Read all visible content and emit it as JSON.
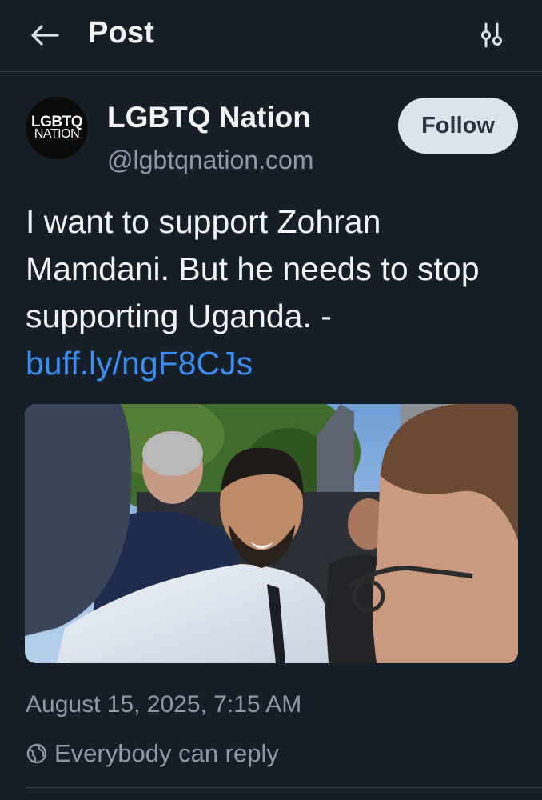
{
  "header": {
    "title": "Post",
    "back_icon": "arrow-left-icon",
    "filter_icon": "sliders-icon"
  },
  "author": {
    "avatar_line1": "LGBTQ",
    "avatar_line2": "NATION",
    "name": "LGBTQ Nation",
    "handle": "@lgbtqnation.com",
    "follow_label": "Follow"
  },
  "post": {
    "text": "I want to support Zohran Mamdani. But he needs to stop supporting Uganda. -",
    "link": "buff.ly/ngF8CJs",
    "image_alt": "Photo of a smiling bearded man in a white shirt and dark tie surrounded by a crowd outdoors",
    "date": "August 15, 2025, 7:15 AM",
    "reply_setting": "Everybody can reply",
    "reply_icon": "globe-icon"
  },
  "colors": {
    "background": "#161e27",
    "link": "#3b8df0",
    "muted": "#8e9aa8",
    "follow_bg": "#dde3ea"
  }
}
